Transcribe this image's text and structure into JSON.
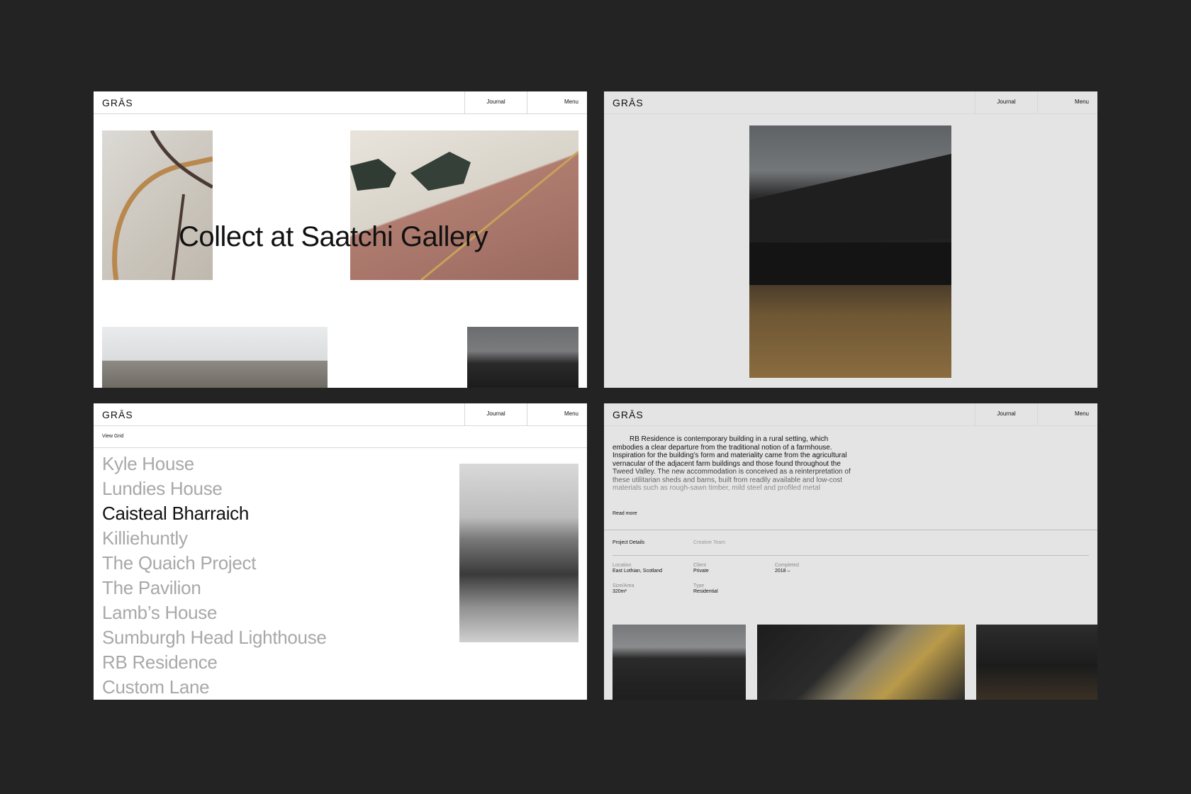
{
  "nav": {
    "logo": "GRĀS",
    "journal": "Journal",
    "menu": "Menu"
  },
  "home": {
    "headline": "Collect at Saatchi Gallery"
  },
  "projects": {
    "view_grid": "View Grid",
    "items": [
      "Kyle House",
      "Lundies House",
      "Caisteal Bharraich",
      "Killiehuntly",
      "The Quaich Project",
      "The Pavilion",
      "Lamb’s House",
      "Sumburgh Head Lighthouse",
      "RB Residence",
      "Custom Lane"
    ],
    "active_index": 2
  },
  "residence": {
    "description": "RB Residence is contemporary building in a rural setting, which embodies a clear departure from the traditional notion of a farmhouse. Inspiration for the building’s form and materiality came from the agricultural vernacular of the adjacent farm buildings and those found throughout the Tweed Valley. The new accommodation is conceived as a reinterpretation of these utilitarian sheds and barns, built from readily available and low-cost materials such as rough-sawn timber, mild steel and profiled metal",
    "read_more": "Read more",
    "tabs": {
      "details": "Project Details",
      "team": "Creative Team"
    },
    "details": {
      "location_label": "Location",
      "location": "East Lothian, Scotland",
      "client_label": "Client",
      "client": "Private",
      "completed_label": "Completed",
      "completed": "2018 –",
      "size_label": "Size/Area",
      "size": "320m²",
      "type_label": "Type",
      "type": "Residential"
    }
  }
}
